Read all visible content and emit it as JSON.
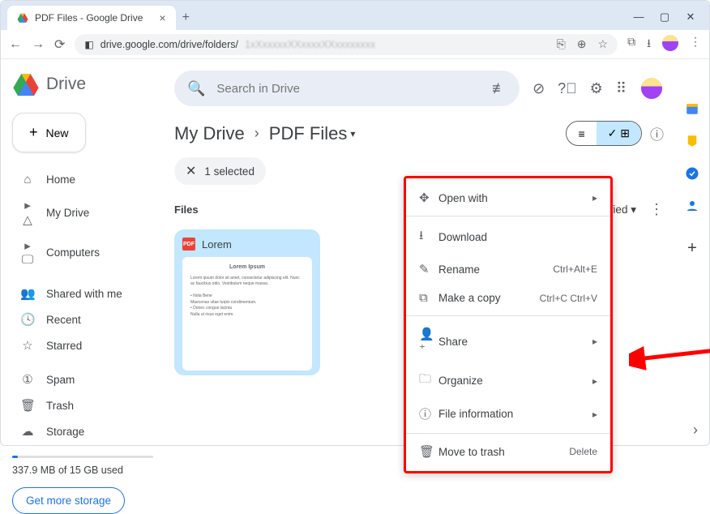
{
  "browser": {
    "tab_title": "PDF Files - Google Drive",
    "url": "drive.google.com/drive/folders/"
  },
  "app": {
    "product": "Drive",
    "search_placeholder": "Search in Drive",
    "new_button": "New"
  },
  "sidebar": {
    "items": [
      {
        "icon": "home",
        "label": "Home"
      },
      {
        "icon": "drive",
        "label": "My Drive"
      },
      {
        "icon": "computers",
        "label": "Computers"
      },
      {
        "icon": "shared",
        "label": "Shared with me"
      },
      {
        "icon": "recent",
        "label": "Recent"
      },
      {
        "icon": "starred",
        "label": "Starred"
      },
      {
        "icon": "spam",
        "label": "Spam"
      },
      {
        "icon": "trash",
        "label": "Trash"
      },
      {
        "icon": "storage",
        "label": "Storage"
      }
    ]
  },
  "storage": {
    "text": "337.9 MB of 15 GB used",
    "cta": "Get more storage"
  },
  "breadcrumb": {
    "root": "My Drive",
    "current": "PDF Files"
  },
  "selection": {
    "text": "1 selected"
  },
  "section": {
    "label": "Files",
    "sort_label": "Last modified"
  },
  "file": {
    "name": "Lorem",
    "badge": "PDF"
  },
  "context_menu": {
    "open_with": "Open with",
    "download": "Download",
    "rename": "Rename",
    "rename_shortcut": "Ctrl+Alt+E",
    "make_copy": "Make a copy",
    "make_copy_shortcut": "Ctrl+C Ctrl+V",
    "share": "Share",
    "organize": "Organize",
    "file_info": "File information",
    "move_trash": "Move to trash",
    "delete_shortcut": "Delete"
  }
}
